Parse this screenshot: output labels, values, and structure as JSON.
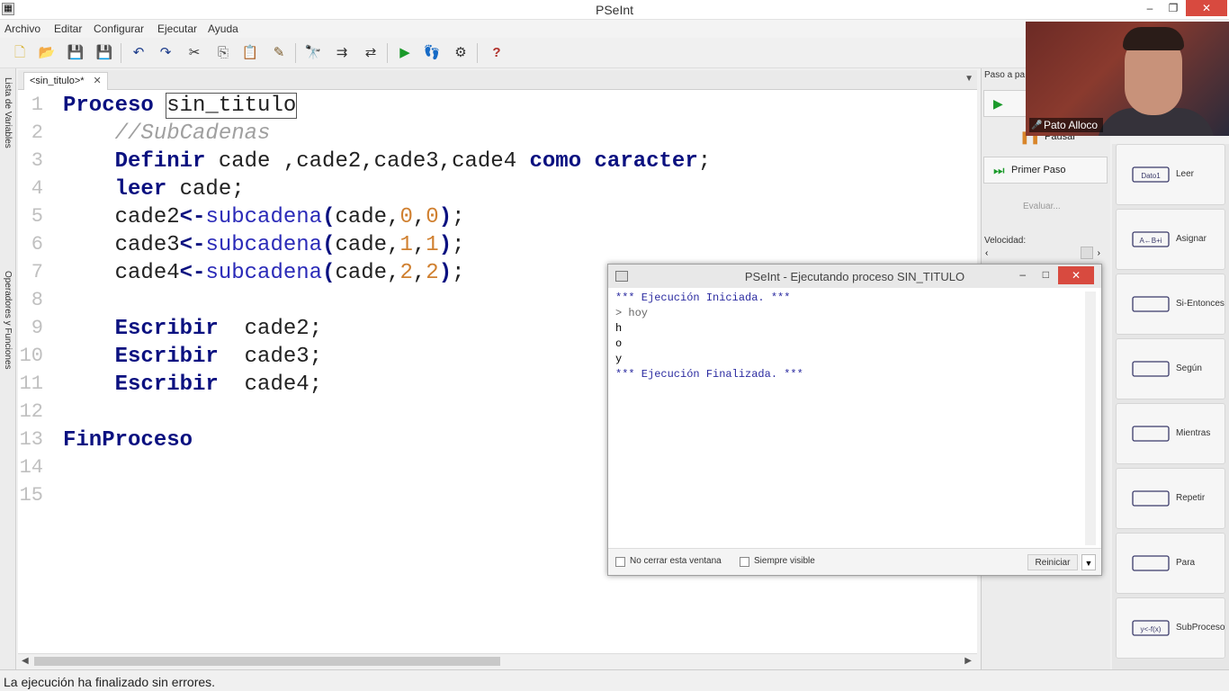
{
  "window": {
    "title": "PSeInt",
    "minimize": "–",
    "restore": "❐",
    "close": "✕"
  },
  "menu": [
    "Archivo",
    "Editar",
    "Configurar",
    "Ejecutar",
    "Ayuda"
  ],
  "left_panel": {
    "variables": "Lista de Variables",
    "operators": "Operadores y Funciones"
  },
  "editor": {
    "tab_label": "<sin_titulo>*",
    "tab_close": "✕",
    "lines": [
      {
        "n": "1",
        "tokens": [
          [
            "kw",
            "Proceso "
          ],
          [
            "boxed",
            "sin_titulo"
          ]
        ]
      },
      {
        "n": "2",
        "tokens": [
          [
            "cm",
            "    //SubCadenas"
          ]
        ]
      },
      {
        "n": "3",
        "tokens": [
          [
            "id",
            "    "
          ],
          [
            "kw",
            "Definir"
          ],
          [
            "id",
            " cade ,cade2,cade3,cade4 "
          ],
          [
            "kw",
            "como caracter"
          ],
          [
            "id",
            ";"
          ]
        ]
      },
      {
        "n": "4",
        "tokens": [
          [
            "id",
            "    "
          ],
          [
            "kw",
            "leer"
          ],
          [
            "id",
            " cade;"
          ]
        ]
      },
      {
        "n": "5",
        "tokens": [
          [
            "id",
            "    cade2"
          ],
          [
            "op",
            "<-"
          ],
          [
            "fn",
            "subcadena"
          ],
          [
            "op",
            "("
          ],
          [
            "id",
            "cade,"
          ],
          [
            "num",
            "0"
          ],
          [
            "id",
            ","
          ],
          [
            "num",
            "0"
          ],
          [
            "op",
            ")"
          ],
          [
            "id",
            ";"
          ]
        ]
      },
      {
        "n": "6",
        "tokens": [
          [
            "id",
            "    cade3"
          ],
          [
            "op",
            "<-"
          ],
          [
            "fn",
            "subcadena"
          ],
          [
            "op",
            "("
          ],
          [
            "id",
            "cade,"
          ],
          [
            "num",
            "1"
          ],
          [
            "id",
            ","
          ],
          [
            "num",
            "1"
          ],
          [
            "op",
            ")"
          ],
          [
            "id",
            ";"
          ]
        ]
      },
      {
        "n": "7",
        "tokens": [
          [
            "id",
            "    cade4"
          ],
          [
            "op",
            "<-"
          ],
          [
            "fn",
            "subcadena"
          ],
          [
            "op",
            "("
          ],
          [
            "id",
            "cade,"
          ],
          [
            "num",
            "2"
          ],
          [
            "id",
            ","
          ],
          [
            "num",
            "2"
          ],
          [
            "op",
            ")"
          ],
          [
            "id",
            ";"
          ]
        ]
      },
      {
        "n": "8",
        "tokens": []
      },
      {
        "n": "9",
        "tokens": [
          [
            "id",
            "    "
          ],
          [
            "kw",
            "Escribir"
          ],
          [
            "id",
            "  cade2;"
          ]
        ]
      },
      {
        "n": "10",
        "tokens": [
          [
            "id",
            "    "
          ],
          [
            "kw",
            "Escribir"
          ],
          [
            "id",
            "  cade3;"
          ]
        ]
      },
      {
        "n": "11",
        "tokens": [
          [
            "id",
            "    "
          ],
          [
            "kw",
            "Escribir"
          ],
          [
            "id",
            "  cade4;"
          ]
        ]
      },
      {
        "n": "12",
        "tokens": []
      },
      {
        "n": "13",
        "tokens": [
          [
            "kw",
            "FinProceso"
          ]
        ]
      },
      {
        "n": "14",
        "tokens": []
      },
      {
        "n": "15",
        "tokens": []
      }
    ]
  },
  "status": "La ejecución ha finalizado sin errores.",
  "step_panel": {
    "header": "Paso a pa",
    "pause": "Pausar",
    "first_step": "Primer Paso",
    "evaluate": "Evaluar...",
    "speed": "Velocidad:"
  },
  "commands": [
    {
      "label": "Leer",
      "icon": "leer-icon",
      "shape_text": "Dato1"
    },
    {
      "label": "Asignar",
      "icon": "asignar-icon",
      "shape_text": "A←B+i"
    },
    {
      "label": "Si-Entonces",
      "icon": "si-entonces-icon",
      "shape_text": ""
    },
    {
      "label": "Según",
      "icon": "segun-icon",
      "shape_text": ""
    },
    {
      "label": "Mientras",
      "icon": "mientras-icon",
      "shape_text": ""
    },
    {
      "label": "Repetir",
      "icon": "repetir-icon",
      "shape_text": ""
    },
    {
      "label": "Para",
      "icon": "para-icon",
      "shape_text": ""
    },
    {
      "label": "SubProceso",
      "icon": "subproceso-icon",
      "shape_text": "y<-f(x)"
    }
  ],
  "webcam": {
    "name": "Pato Alloco"
  },
  "console": {
    "title": "PSeInt - Ejecutando proceso SIN_TITULO",
    "output": [
      {
        "kind": "sys",
        "text": "*** Ejecución Iniciada. ***"
      },
      {
        "kind": "inp",
        "text": "> hoy"
      },
      {
        "kind": "out",
        "text": "h"
      },
      {
        "kind": "out",
        "text": "o"
      },
      {
        "kind": "out",
        "text": "y"
      },
      {
        "kind": "sys",
        "text": "*** Ejecución Finalizada. ***"
      }
    ],
    "no_close_label": "No cerrar esta ventana",
    "always_visible_label": "Siempre visible",
    "restart_label": "Reiniciar"
  },
  "colors": {
    "keyword": "#0b1180",
    "function": "#2a2ab8",
    "number": "#d08030",
    "comment": "#a0a0a0",
    "close": "#d84a3f"
  }
}
